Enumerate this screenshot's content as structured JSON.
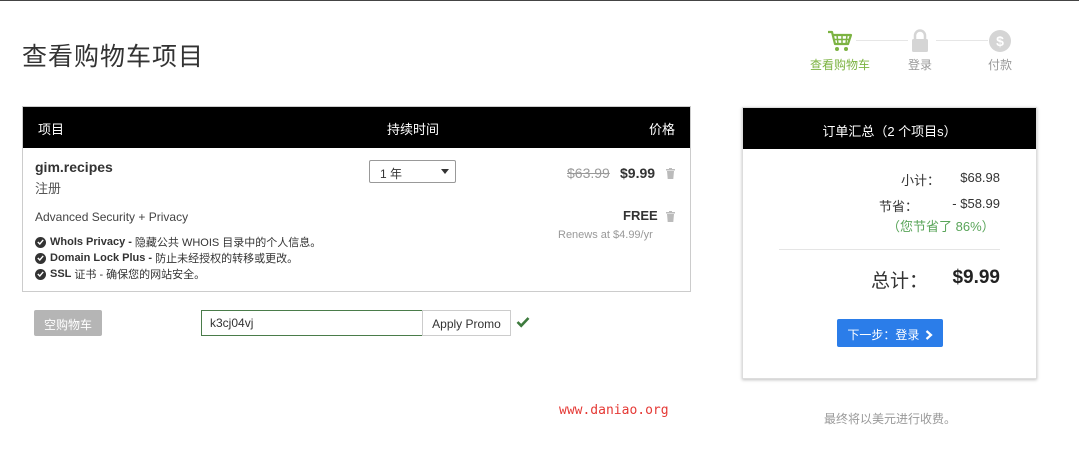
{
  "page": {
    "title": "查看购物车项目"
  },
  "steps": [
    {
      "label": "查看购物车",
      "icon": "cart-icon",
      "active": true
    },
    {
      "label": "登录",
      "icon": "lock-icon",
      "active": false
    },
    {
      "label": "付款",
      "icon": "dollar-icon",
      "active": false
    }
  ],
  "colors": {
    "active_step": "#7cb342",
    "primary_button": "#2b7de9",
    "savings": "#5aa55a",
    "header_bg": "#000000"
  },
  "cart": {
    "headers": {
      "item": "项目",
      "duration": "持续时间",
      "price": "价格"
    },
    "item": {
      "name": "gim.recipes",
      "type": "注册",
      "duration": "1 年",
      "old_price": "$63.99",
      "price": "$9.99"
    },
    "addon": {
      "title": "Advanced Security + Privacy",
      "price": "FREE",
      "renews": "Renews at $4.99/yr",
      "features": [
        {
          "name": "WhoIs Privacy -",
          "desc": "隐藏公共 WHOIS 目录中的个人信息。"
        },
        {
          "name": "Domain Lock Plus -",
          "desc": "防止未经授权的转移或更改。"
        },
        {
          "name": "SSL",
          "desc": "证书 - 确保您的网站安全。"
        }
      ]
    }
  },
  "actions": {
    "empty_cart": "空购物车",
    "promo_value": "k3cj04vj",
    "apply_promo": "Apply Promo"
  },
  "summary": {
    "title": "订单汇总（2 个项目s）",
    "subtotal_label": "小计：",
    "subtotal": "$68.98",
    "savings_label": "节省：",
    "savings": "- $58.99",
    "saved_note": "（您节省了 86%）",
    "total_label": "总计：",
    "total": "$9.99",
    "next_button": "下一步：登录"
  },
  "footer": {
    "note": "最终将以美元进行收费。",
    "watermark": "www.daniao.org"
  }
}
